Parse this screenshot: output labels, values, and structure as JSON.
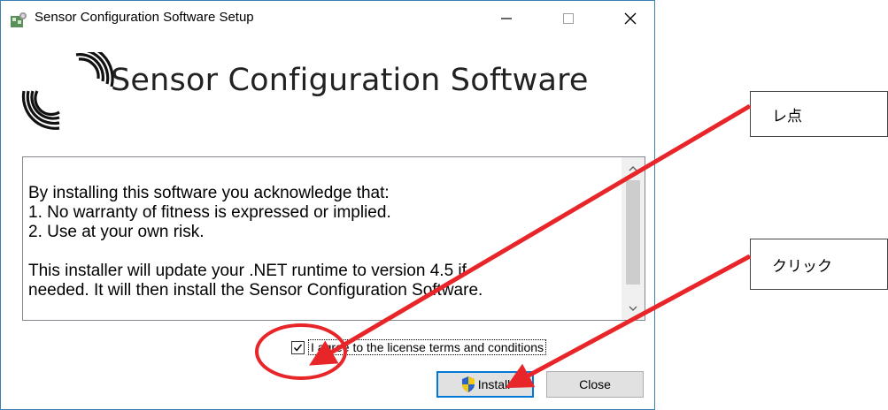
{
  "window": {
    "title": "Sensor Configuration Software Setup",
    "controls": {
      "minimize": "minimize-icon",
      "maximize": "maximize-icon",
      "close": "close-icon"
    }
  },
  "header": {
    "product_name": "Sensor Configuration Software"
  },
  "license_text": {
    "lines": [
      "By installing this software you acknowledge that:",
      "1. No warranty of fitness is expressed or implied.",
      "2. Use at your own risk.",
      "",
      "This installer will update your .NET runtime to version 4.5 if",
      "needed. It will then install the Sensor Configuration Software."
    ]
  },
  "agree": {
    "label": "I agree to the license terms and conditions",
    "checked": true
  },
  "buttons": {
    "install": "Install",
    "close": "Close"
  },
  "annotations": {
    "box1": "レ点",
    "box2": "クリック",
    "color": "#e8262a"
  }
}
